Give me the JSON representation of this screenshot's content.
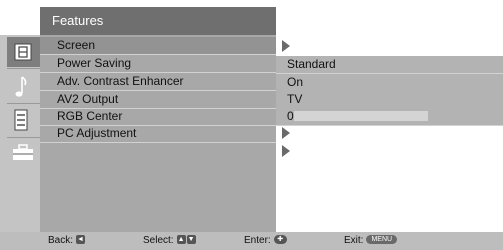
{
  "menu": {
    "title": "Features",
    "items": [
      {
        "label": "Screen",
        "value": ""
      },
      {
        "label": "Power Saving",
        "value": "Standard"
      },
      {
        "label": "Adv. Contrast Enhancer",
        "value": "On"
      },
      {
        "label": "AV2 Output",
        "value": "TV"
      },
      {
        "label": "RGB Center",
        "value": "0"
      },
      {
        "label": "PC Adjustment",
        "value": ""
      }
    ]
  },
  "categories": [
    "picture-icon",
    "music-note-icon",
    "channel-list-icon",
    "features-icon"
  ],
  "footer": {
    "back": "Back:",
    "back_key": "◄",
    "select": "Select:",
    "select_key_up": "▲",
    "select_key_down": "▼",
    "enter": "Enter:",
    "enter_key": "✚",
    "exit": "Exit:",
    "exit_key": "MENU"
  },
  "colors": {
    "title_bar": "#6f6f6f",
    "panel": "#a8a8a8",
    "selected_row": "#939393",
    "value_rows": "#b3b3b3",
    "sidebar": "#c4c4c4",
    "footer": "#bdbdbd"
  }
}
